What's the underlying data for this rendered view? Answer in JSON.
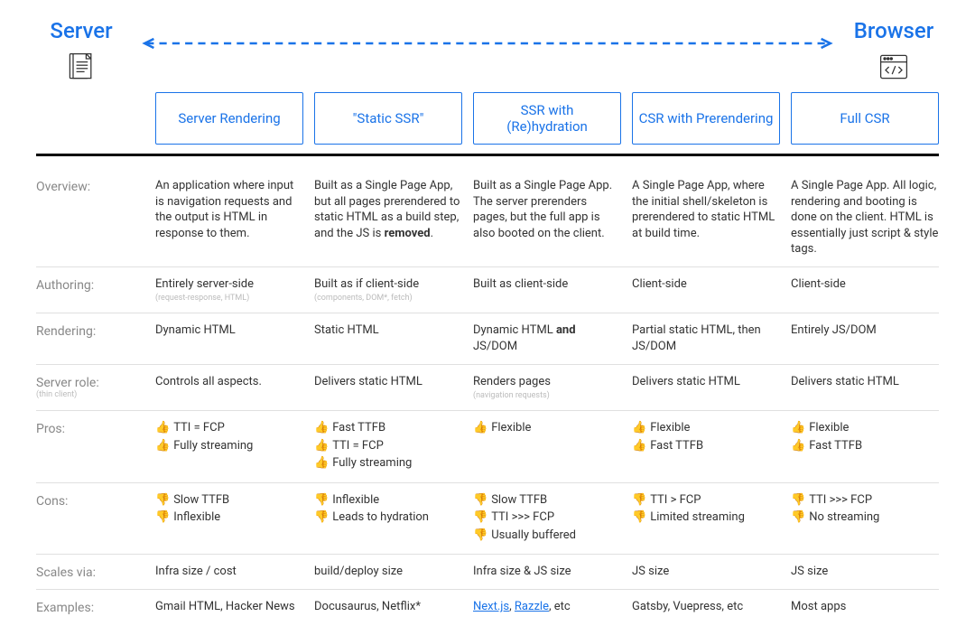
{
  "header": {
    "left_label": "Server",
    "right_label": "Browser"
  },
  "columns": [
    "Server Rendering",
    "\"Static SSR\"",
    "SSR with (Re)hydration",
    "CSR with Prerendering",
    "Full CSR"
  ],
  "rows": {
    "overview": {
      "label": "Overview:",
      "cells": [
        "An application where input is navigation requests and the output is HTML in response to them.",
        "Built as a Single Page App, but all pages prerendered to static HTML as a build step, and the JS is <strong>removed</strong>.",
        "Built as a Single Page App. The server prerenders pages, but the full app is also booted on the client.",
        "A Single Page App, where the initial shell/skeleton is prerendered to static HTML at build time.",
        "A Single Page App. All logic, rendering and booting is done on the client. HTML is essentially just script & style tags."
      ]
    },
    "authoring": {
      "label": "Authoring:",
      "cells": [
        {
          "text": "Entirely server-side",
          "sub": "(request-response, HTML)"
        },
        {
          "text": "Built as if client-side",
          "sub": "(components, DOM*, fetch)"
        },
        {
          "text": "Built as client-side"
        },
        {
          "text": "Client-side"
        },
        {
          "text": "Client-side"
        }
      ]
    },
    "rendering": {
      "label": "Rendering:",
      "cells": [
        "Dynamic HTML",
        "Static HTML",
        "Dynamic HTML <strong>and</strong> JS/DOM",
        "Partial static HTML, then JS/DOM",
        "Entirely JS/DOM"
      ]
    },
    "server_role": {
      "label": "Server role:",
      "label_sub": "(thin client)",
      "cells": [
        {
          "text": "Controls all aspects."
        },
        {
          "text": "Delivers static HTML"
        },
        {
          "text": "Renders pages",
          "sub": "(navigation requests)"
        },
        {
          "text": "Delivers static HTML"
        },
        {
          "text": "Delivers static HTML"
        }
      ]
    },
    "pros": {
      "label": "Pros:",
      "cells": [
        [
          "TTI = FCP",
          "Fully streaming"
        ],
        [
          "Fast TTFB",
          "TTI = FCP",
          "Fully streaming"
        ],
        [
          "Flexible"
        ],
        [
          "Flexible",
          "Fast TTFB"
        ],
        [
          "Flexible",
          "Fast TTFB"
        ]
      ]
    },
    "cons": {
      "label": "Cons:",
      "cells": [
        [
          "Slow TTFB",
          "Inflexible"
        ],
        [
          "Inflexible",
          "Leads to hydration"
        ],
        [
          "Slow TTFB",
          "TTI >>> FCP",
          "Usually buffered"
        ],
        [
          "TTI > FCP",
          "Limited streaming"
        ],
        [
          "TTI >>> FCP",
          "No streaming"
        ]
      ]
    },
    "scales": {
      "label": "Scales via:",
      "cells": [
        "Infra size / cost",
        "build/deploy size",
        "Infra size & JS size",
        "JS size",
        "JS size"
      ]
    },
    "examples": {
      "label": "Examples:",
      "cells_html": [
        "Gmail HTML, Hacker News",
        "Docusaurus, Netflix*",
        "<span class='link' data-name='link-nextjs' data-interactable='true'>Next.js</span>, <span class='link' data-name='link-razzle' data-interactable='true'>Razzle</span>, etc",
        "Gatsby, Vuepress, etc",
        "Most apps"
      ]
    }
  }
}
